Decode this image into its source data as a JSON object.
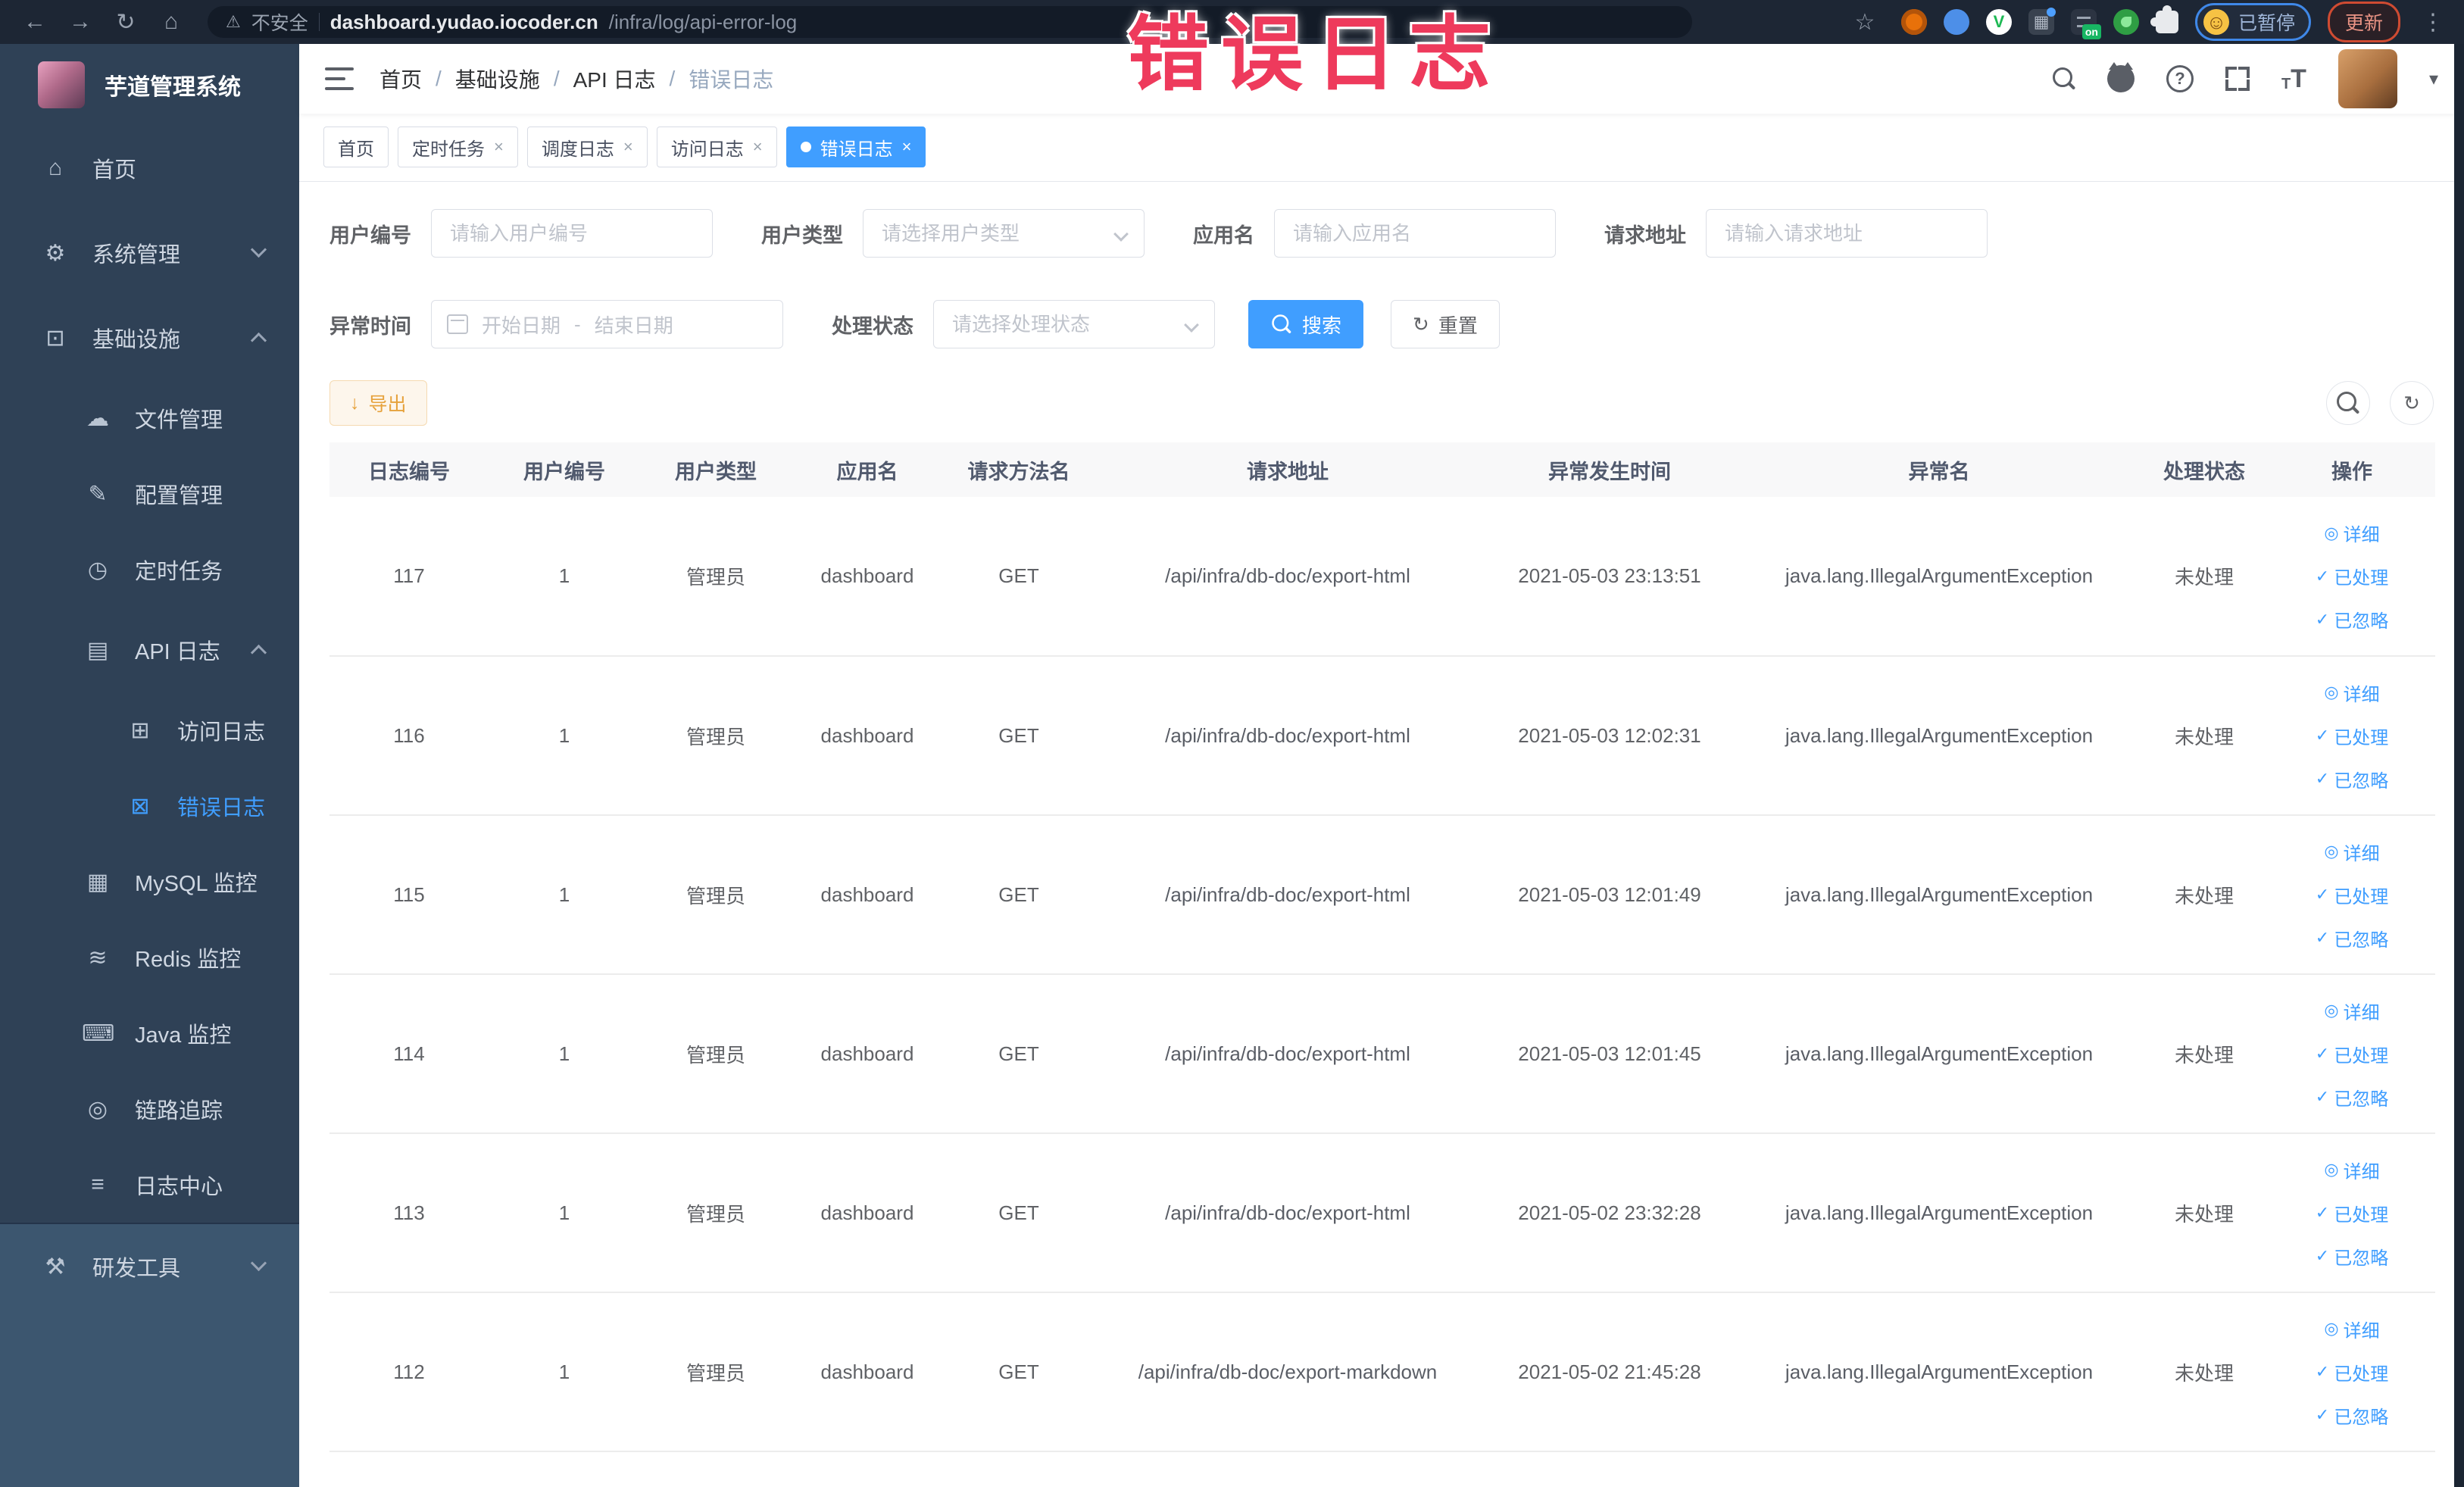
{
  "annotation": {
    "text": "错误日志"
  },
  "browser": {
    "security_label": "不安全",
    "url_domain": "dashboard.yudao.iocoder.cn",
    "url_path": "/infra/log/api-error-log",
    "extension_on_badge": "on",
    "paused_label": "已暂停",
    "update_label": "更新"
  },
  "sidebar": {
    "logo_title": "芋道管理系统",
    "items": [
      {
        "label": "首页",
        "icon": "home-icon"
      },
      {
        "label": "系统管理",
        "icon": "gear-icon",
        "chevron": "down"
      },
      {
        "label": "基础设施",
        "icon": "infra-icon",
        "chevron": "up"
      },
      {
        "label": "文件管理",
        "icon": "cloud-file-icon"
      },
      {
        "label": "配置管理",
        "icon": "config-edit-icon"
      },
      {
        "label": "定时任务",
        "icon": "timer-icon"
      },
      {
        "label": "API 日志",
        "icon": "api-log-icon",
        "chevron": "up"
      },
      {
        "label": "访问日志",
        "icon": "access-log-icon"
      },
      {
        "label": "错误日志",
        "icon": "error-log-icon",
        "active": true
      },
      {
        "label": "MySQL 监控",
        "icon": "mysql-icon"
      },
      {
        "label": "Redis 监控",
        "icon": "redis-icon"
      },
      {
        "label": "Java 监控",
        "icon": "java-icon"
      },
      {
        "label": "链路追踪",
        "icon": "trace-eye-icon"
      },
      {
        "label": "日志中心",
        "icon": "log-center-icon"
      },
      {
        "label": "研发工具",
        "icon": "devtools-icon",
        "chevron": "down"
      }
    ]
  },
  "navbar": {
    "breadcrumb": [
      "首页",
      "基础设施",
      "API 日志",
      "错误日志"
    ]
  },
  "tabs": [
    {
      "label": "首页",
      "closable": false,
      "active": false
    },
    {
      "label": "定时任务",
      "closable": true,
      "active": false
    },
    {
      "label": "调度日志",
      "closable": true,
      "active": false
    },
    {
      "label": "访问日志",
      "closable": true,
      "active": false
    },
    {
      "label": "错误日志",
      "closable": true,
      "active": true
    }
  ],
  "filters": {
    "user_id": {
      "label": "用户编号",
      "placeholder": "请输入用户编号"
    },
    "user_type": {
      "label": "用户类型",
      "placeholder": "请选择用户类型"
    },
    "app_name": {
      "label": "应用名",
      "placeholder": "请输入应用名"
    },
    "request_url": {
      "label": "请求地址",
      "placeholder": "请输入请求地址"
    },
    "exception_time": {
      "label": "异常时间",
      "start_placeholder": "开始日期",
      "separator": "-",
      "end_placeholder": "结束日期"
    },
    "process_status": {
      "label": "处理状态",
      "placeholder": "请选择处理状态"
    },
    "search_button": "搜索",
    "reset_button": "重置"
  },
  "toolbar": {
    "export_button": "导出"
  },
  "table": {
    "columns": [
      "日志编号",
      "用户编号",
      "用户类型",
      "应用名",
      "请求方法名",
      "请求地址",
      "异常发生时间",
      "异常名",
      "处理状态",
      "操作"
    ],
    "actions": {
      "detail": "详细",
      "processed": "已处理",
      "ignored": "已忽略"
    },
    "rows": [
      {
        "log_id": "117",
        "user_id": "1",
        "user_type": "管理员",
        "app_name": "dashboard",
        "method": "GET",
        "url": "/api/infra/db-doc/export-html",
        "time": "2021-05-03 23:13:51",
        "exception": "java.lang.IllegalArgumentException",
        "status": "未处理"
      },
      {
        "log_id": "116",
        "user_id": "1",
        "user_type": "管理员",
        "app_name": "dashboard",
        "method": "GET",
        "url": "/api/infra/db-doc/export-html",
        "time": "2021-05-03 12:02:31",
        "exception": "java.lang.IllegalArgumentException",
        "status": "未处理"
      },
      {
        "log_id": "115",
        "user_id": "1",
        "user_type": "管理员",
        "app_name": "dashboard",
        "method": "GET",
        "url": "/api/infra/db-doc/export-html",
        "time": "2021-05-03 12:01:49",
        "exception": "java.lang.IllegalArgumentException",
        "status": "未处理"
      },
      {
        "log_id": "114",
        "user_id": "1",
        "user_type": "管理员",
        "app_name": "dashboard",
        "method": "GET",
        "url": "/api/infra/db-doc/export-html",
        "time": "2021-05-03 12:01:45",
        "exception": "java.lang.IllegalArgumentException",
        "status": "未处理"
      },
      {
        "log_id": "113",
        "user_id": "1",
        "user_type": "管理员",
        "app_name": "dashboard",
        "method": "GET",
        "url": "/api/infra/db-doc/export-html",
        "time": "2021-05-02 23:32:28",
        "exception": "java.lang.IllegalArgumentException",
        "status": "未处理"
      },
      {
        "log_id": "112",
        "user_id": "1",
        "user_type": "管理员",
        "app_name": "dashboard",
        "method": "GET",
        "url": "/api/infra/db-doc/export-markdown",
        "time": "2021-05-02 21:45:28",
        "exception": "java.lang.IllegalArgumentException",
        "status": "未处理"
      }
    ]
  },
  "colors": {
    "primary": "#409eff",
    "annotation": "#ee3a5c",
    "warning": "#e6a23c",
    "sidebar_bg": "#2f4156"
  }
}
